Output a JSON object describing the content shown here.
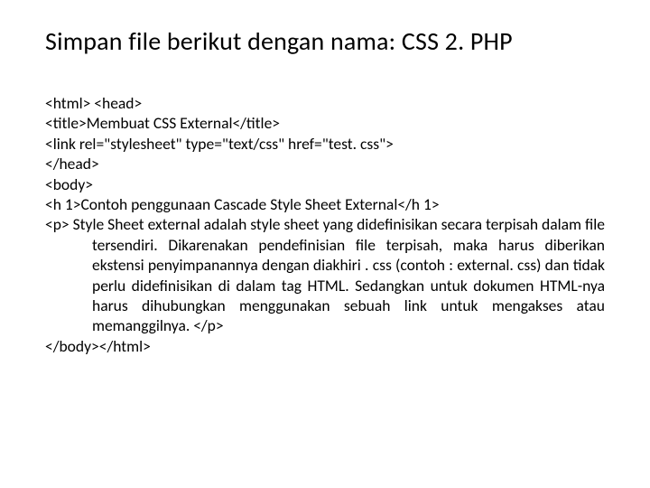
{
  "title": "Simpan file berikut dengan nama: CSS 2. PHP",
  "code": {
    "l1": "<html> <head>",
    "l2": "<title>Membuat CSS External</title>",
    "l3": "<link rel=\"stylesheet\" type=\"text/css\" href=\"test. css\">",
    "l4": "</head>",
    "l5": "<body>",
    "l6": " <h 1>Contoh penggunaan Cascade Style Sheet External</h 1>",
    "l7": " <p> Style Sheet external adalah style sheet yang didefinisikan secara terpisah dalam file tersendiri. Dikarenakan pendefinisian file terpisah, maka harus diberikan ekstensi penyimpanannya dengan diakhiri . css  (contoh : external. css) dan tidak perlu didefinisikan di dalam tag HTML. Sedangkan untuk dokumen HTML-nya harus dihubungkan menggunakan sebuah link untuk mengakses atau memanggilnya. </p>",
    "l8": "</body></html>"
  }
}
